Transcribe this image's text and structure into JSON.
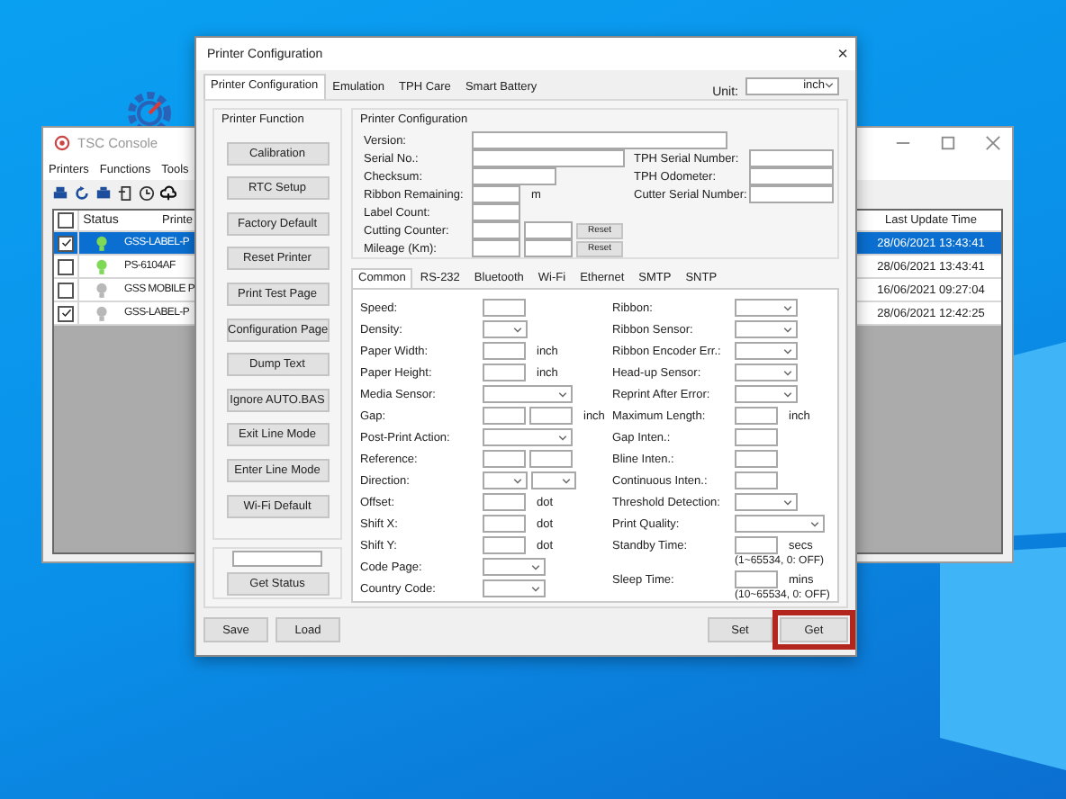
{
  "console": {
    "title": "TSC Console",
    "menu": [
      "Printers",
      "Functions",
      "Tools"
    ],
    "all_checked": false,
    "status_header": "Status",
    "printer_header": "Printe",
    "time_header": "Last Update Time",
    "rows": [
      {
        "selected": true,
        "checked": true,
        "color": "#7ed957",
        "name": "GSS-LABEL-P",
        "time": "28/06/2021 13:43:41"
      },
      {
        "selected": false,
        "checked": false,
        "color": "#7ed957",
        "name": "PS-6104AF",
        "time": "28/06/2021 13:43:41"
      },
      {
        "selected": false,
        "checked": false,
        "color": "#b8b8b8",
        "name": "GSS MOBILE P",
        "time": "16/06/2021 09:27:04"
      },
      {
        "selected": false,
        "checked": true,
        "color": "#b8b8b8",
        "name": "GSS-LABEL-P",
        "time": "28/06/2021 12:42:25"
      }
    ]
  },
  "dialog": {
    "title": "Printer Configuration",
    "close": "×",
    "tabs": [
      {
        "label": "Printer Configuration",
        "selected": true
      },
      {
        "label": "Emulation",
        "selected": false
      },
      {
        "label": "TPH Care",
        "selected": false
      },
      {
        "label": "Smart Battery",
        "selected": false
      }
    ],
    "unit": {
      "label": "Unit:",
      "value": "inch"
    },
    "function_group": {
      "title": "Printer Function",
      "buttons": [
        "Calibration",
        "RTC Setup",
        "Factory Default",
        "Reset Printer",
        "Print Test Page",
        "Configuration Page",
        "Dump Text",
        "Ignore AUTO.BAS",
        "Exit Line Mode",
        "Enter Line Mode",
        "Wi-Fi Default"
      ]
    },
    "status_group": {
      "button": "Get Status"
    },
    "info_group": {
      "title": "Printer Configuration",
      "left": [
        {
          "label": "Version:",
          "controls": [
            {
              "kind": "wide"
            }
          ]
        },
        {
          "label": "Serial No.:",
          "controls": [
            {
              "kind": "medium"
            }
          ]
        },
        {
          "label": "Checksum:",
          "controls": [
            {
              "kind": "short"
            }
          ]
        },
        {
          "label": "Ribbon Remaining:",
          "controls": [
            {
              "kind": "tiny"
            }
          ],
          "unit": "m"
        },
        {
          "label": "Label Count:",
          "controls": [
            {
              "kind": "tiny"
            }
          ]
        },
        {
          "label": "Cutting Counter:",
          "controls": [
            {
              "kind": "tiny"
            },
            {
              "kind": "tiny"
            }
          ],
          "button": "Reset"
        },
        {
          "label": "Mileage (Km):",
          "controls": [
            {
              "kind": "tiny"
            },
            {
              "kind": "tiny"
            }
          ],
          "button": "Reset"
        }
      ],
      "right": [
        {
          "label": "TPH Serial Number:",
          "controls": [
            {
              "kind": "short"
            }
          ]
        },
        {
          "label": "TPH Odometer:",
          "controls": [
            {
              "kind": "short"
            }
          ]
        },
        {
          "label": "Cutter Serial Number:",
          "controls": [
            {
              "kind": "short"
            }
          ]
        }
      ]
    },
    "settings": {
      "tabs": [
        {
          "label": "Common",
          "selected": true
        },
        {
          "label": "RS-232",
          "selected": false
        },
        {
          "label": "Bluetooth",
          "selected": false
        },
        {
          "label": "Wi-Fi",
          "selected": false
        },
        {
          "label": "Ethernet",
          "selected": false
        },
        {
          "label": "SMTP",
          "selected": false
        },
        {
          "label": "SNTP",
          "selected": false
        }
      ],
      "left": [
        {
          "label": "Speed:",
          "controls": [
            {
              "kind": "text"
            }
          ]
        },
        {
          "label": "Density:",
          "controls": [
            {
              "kind": "select"
            }
          ]
        },
        {
          "label": "Paper Width:",
          "controls": [
            {
              "kind": "text"
            }
          ],
          "unit": "inch"
        },
        {
          "label": "Paper Height:",
          "controls": [
            {
              "kind": "text"
            }
          ],
          "unit": "inch"
        },
        {
          "label": "Media Sensor:",
          "controls": [
            {
              "kind": "select_wide"
            }
          ]
        },
        {
          "label": "Gap:",
          "controls": [
            {
              "kind": "text"
            },
            {
              "kind": "text"
            }
          ],
          "unit": "inch"
        },
        {
          "label": "Post-Print Action:",
          "controls": [
            {
              "kind": "select_wide"
            }
          ]
        },
        {
          "label": "Reference:",
          "controls": [
            {
              "kind": "text"
            },
            {
              "kind": "text"
            }
          ]
        },
        {
          "label": "Direction:",
          "controls": [
            {
              "kind": "select"
            },
            {
              "kind": "select"
            }
          ]
        },
        {
          "label": "Offset:",
          "controls": [
            {
              "kind": "text"
            }
          ],
          "unit": "dot"
        },
        {
          "label": "Shift X:",
          "controls": [
            {
              "kind": "text"
            }
          ],
          "unit": "dot"
        },
        {
          "label": "Shift Y:",
          "controls": [
            {
              "kind": "text"
            }
          ],
          "unit": "dot"
        },
        {
          "label": "Code Page:",
          "controls": [
            {
              "kind": "select_mid"
            }
          ]
        },
        {
          "label": "Country Code:",
          "controls": [
            {
              "kind": "select_mid"
            }
          ]
        }
      ],
      "right": [
        {
          "label": "Ribbon:",
          "controls": [
            {
              "kind": "select_mid"
            }
          ]
        },
        {
          "label": "Ribbon Sensor:",
          "controls": [
            {
              "kind": "select_mid"
            }
          ]
        },
        {
          "label": "Ribbon Encoder Err.:",
          "controls": [
            {
              "kind": "select_mid"
            }
          ]
        },
        {
          "label": "Head-up Sensor:",
          "controls": [
            {
              "kind": "select_mid"
            }
          ]
        },
        {
          "label": "Reprint After Error:",
          "controls": [
            {
              "kind": "select_mid"
            }
          ]
        },
        {
          "label": "Maximum Length:",
          "controls": [
            {
              "kind": "text"
            }
          ],
          "unit": "inch"
        },
        {
          "label": "Gap Inten.:",
          "controls": [
            {
              "kind": "text"
            }
          ]
        },
        {
          "label": "Bline Inten.:",
          "controls": [
            {
              "kind": "text"
            }
          ]
        },
        {
          "label": "Continuous Inten.:",
          "controls": [
            {
              "kind": "text"
            }
          ]
        },
        {
          "label": "Threshold Detection:",
          "controls": [
            {
              "kind": "select_mid"
            }
          ]
        },
        {
          "label": "Print Quality:",
          "controls": [
            {
              "kind": "select_wide"
            }
          ]
        },
        {
          "label": "Standby Time:",
          "controls": [
            {
              "kind": "text"
            }
          ],
          "unit": "secs",
          "note": "(1~65534, 0: OFF)"
        },
        {
          "label": "Sleep Time:",
          "controls": [
            {
              "kind": "text"
            }
          ],
          "unit": "mins",
          "note": "(10~65534, 0: OFF)"
        }
      ]
    },
    "footer": {
      "left_buttons": [
        {
          "label": "Save",
          "highlighted": false
        },
        {
          "label": "Load",
          "highlighted": false
        }
      ],
      "right_buttons": [
        {
          "label": "Set",
          "highlighted": false
        },
        {
          "label": "Get",
          "highlighted": true
        }
      ]
    }
  }
}
